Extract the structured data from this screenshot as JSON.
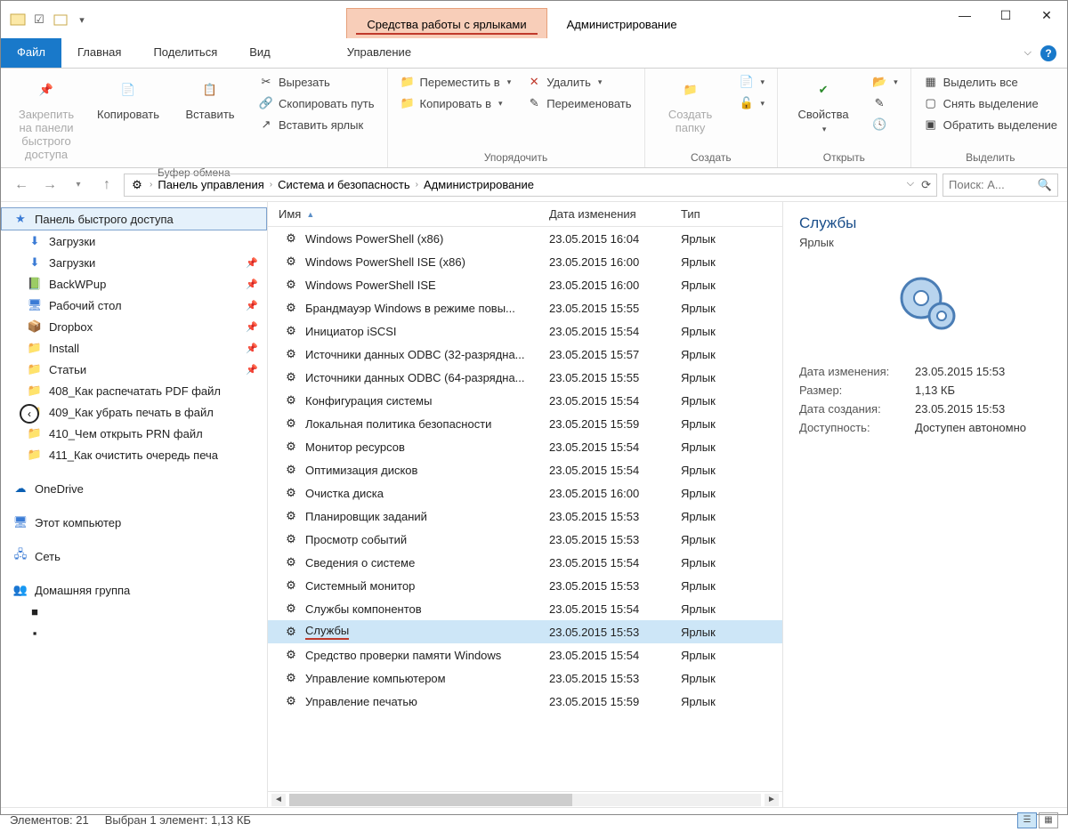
{
  "title": {
    "context_tab": "Средства работы с ярлыками",
    "main": "Администрирование"
  },
  "tabs": {
    "file": "Файл",
    "home": "Главная",
    "share": "Поделиться",
    "view": "Вид",
    "manage": "Управление"
  },
  "ribbon": {
    "pin": "Закрепить на панели\nбыстрого доступа",
    "copy": "Копировать",
    "paste": "Вставить",
    "cut": "Вырезать",
    "copy_path": "Скопировать путь",
    "paste_shortcut": "Вставить ярлык",
    "clipboard_label": "Буфер обмена",
    "move_to": "Переместить в",
    "copy_to": "Копировать в",
    "delete": "Удалить",
    "rename": "Переименовать",
    "organize_label": "Упорядочить",
    "new_folder": "Создать\nпапку",
    "new_label": "Создать",
    "properties": "Свойства",
    "open_label": "Открыть",
    "select_all": "Выделить все",
    "select_none": "Снять выделение",
    "invert": "Обратить выделение",
    "select_label": "Выделить"
  },
  "breadcrumb": {
    "items": [
      "Панель управления",
      "Система и безопасность",
      "Администрирование"
    ]
  },
  "search": {
    "placeholder": "Поиск: А..."
  },
  "tree": {
    "quick_access": "Панель быстрого доступа",
    "items": [
      {
        "label": "Загрузки",
        "icon": "download",
        "pin": false
      },
      {
        "label": "Загрузки",
        "icon": "download",
        "pin": true
      },
      {
        "label": "BackWPup",
        "icon": "folder-green",
        "pin": true
      },
      {
        "label": "Рабочий стол",
        "icon": "desktop",
        "pin": true
      },
      {
        "label": "Dropbox",
        "icon": "dropbox",
        "pin": true
      },
      {
        "label": "Install",
        "icon": "folder",
        "pin": true
      },
      {
        "label": "Статьи",
        "icon": "folder",
        "pin": true
      },
      {
        "label": "408_Как распечатать PDF файл",
        "icon": "folder",
        "pin": false
      },
      {
        "label": "409_Как убрать печать в файл",
        "icon": "folder",
        "pin": false
      },
      {
        "label": "410_Чем открыть PRN файл",
        "icon": "folder",
        "pin": false
      },
      {
        "label": "411_Как очистить очередь печа",
        "icon": "folder",
        "pin": false
      }
    ],
    "onedrive": "OneDrive",
    "this_pc": "Этот компьютер",
    "network": "Сеть",
    "homegroup": "Домашняя группа"
  },
  "columns": {
    "name": "Имя",
    "date": "Дата изменения",
    "type": "Тип"
  },
  "rows": [
    {
      "name": "Windows PowerShell (x86)",
      "date": "23.05.2015 16:04",
      "type": "Ярлык"
    },
    {
      "name": "Windows PowerShell ISE (x86)",
      "date": "23.05.2015 16:00",
      "type": "Ярлык"
    },
    {
      "name": "Windows PowerShell ISE",
      "date": "23.05.2015 16:00",
      "type": "Ярлык"
    },
    {
      "name": "Брандмауэр Windows в режиме повы...",
      "date": "23.05.2015 15:55",
      "type": "Ярлык"
    },
    {
      "name": "Инициатор iSCSI",
      "date": "23.05.2015 15:54",
      "type": "Ярлык"
    },
    {
      "name": "Источники данных ODBC (32-разрядна...",
      "date": "23.05.2015 15:57",
      "type": "Ярлык"
    },
    {
      "name": "Источники данных ODBC (64-разрядна...",
      "date": "23.05.2015 15:55",
      "type": "Ярлык"
    },
    {
      "name": "Конфигурация системы",
      "date": "23.05.2015 15:54",
      "type": "Ярлык"
    },
    {
      "name": "Локальная политика безопасности",
      "date": "23.05.2015 15:59",
      "type": "Ярлык"
    },
    {
      "name": "Монитор ресурсов",
      "date": "23.05.2015 15:54",
      "type": "Ярлык"
    },
    {
      "name": "Оптимизация дисков",
      "date": "23.05.2015 15:54",
      "type": "Ярлык"
    },
    {
      "name": "Очистка диска",
      "date": "23.05.2015 16:00",
      "type": "Ярлык"
    },
    {
      "name": "Планировщик заданий",
      "date": "23.05.2015 15:53",
      "type": "Ярлык"
    },
    {
      "name": "Просмотр событий",
      "date": "23.05.2015 15:53",
      "type": "Ярлык"
    },
    {
      "name": "Сведения о системе",
      "date": "23.05.2015 15:54",
      "type": "Ярлык"
    },
    {
      "name": "Системный монитор",
      "date": "23.05.2015 15:53",
      "type": "Ярлык"
    },
    {
      "name": "Службы компонентов",
      "date": "23.05.2015 15:54",
      "type": "Ярлык"
    },
    {
      "name": "Службы",
      "date": "23.05.2015 15:53",
      "type": "Ярлык",
      "selected": true
    },
    {
      "name": "Средство проверки памяти Windows",
      "date": "23.05.2015 15:54",
      "type": "Ярлык"
    },
    {
      "name": "Управление компьютером",
      "date": "23.05.2015 15:53",
      "type": "Ярлык"
    },
    {
      "name": "Управление печатью",
      "date": "23.05.2015 15:59",
      "type": "Ярлык"
    }
  ],
  "preview": {
    "title": "Службы",
    "subtitle": "Ярлык",
    "props": {
      "modified_lbl": "Дата изменения:",
      "modified": "23.05.2015 15:53",
      "size_lbl": "Размер:",
      "size": "1,13 КБ",
      "created_lbl": "Дата создания:",
      "created": "23.05.2015 15:53",
      "avail_lbl": "Доступность:",
      "avail": "Доступен автономно"
    }
  },
  "status": {
    "count": "Элементов: 21",
    "selection": "Выбран 1 элемент: 1,13 КБ"
  }
}
